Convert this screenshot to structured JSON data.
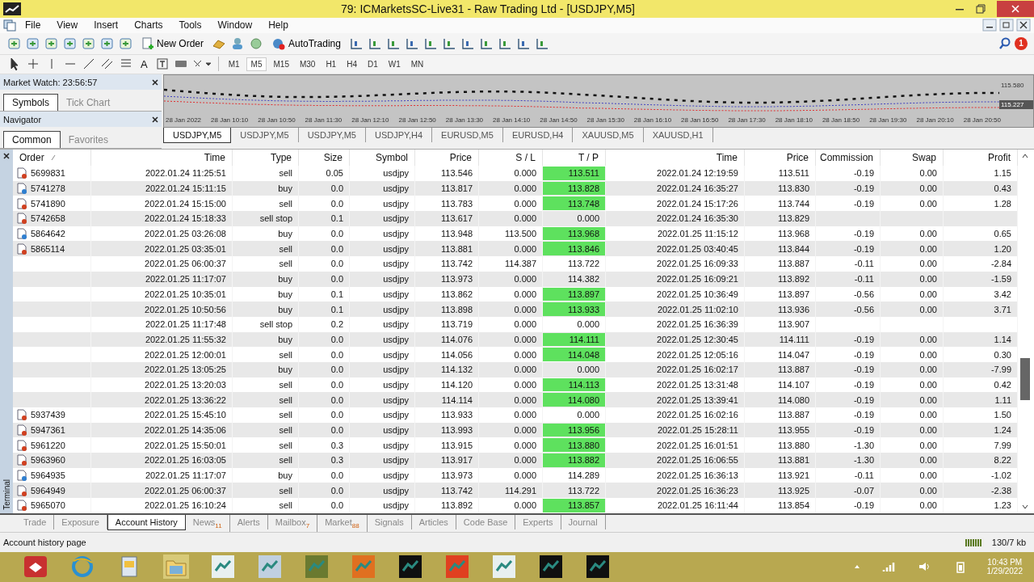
{
  "window": {
    "title": "79: ICMarketsSC-Live31 - Raw Trading Ltd - [USDJPY,M5]"
  },
  "menu": [
    "File",
    "View",
    "Insert",
    "Charts",
    "Tools",
    "Window",
    "Help"
  ],
  "toolbar": {
    "new_order": "New Order",
    "auto_trading": "AutoTrading",
    "text_tool": "A",
    "notifications": "1"
  },
  "timeframes": [
    {
      "label": "M1",
      "selected": false
    },
    {
      "label": "M5",
      "selected": true
    },
    {
      "label": "M15",
      "selected": false
    },
    {
      "label": "M30",
      "selected": false
    },
    {
      "label": "H1",
      "selected": false
    },
    {
      "label": "H4",
      "selected": false
    },
    {
      "label": "D1",
      "selected": false
    },
    {
      "label": "W1",
      "selected": false
    },
    {
      "label": "MN",
      "selected": false
    }
  ],
  "market_watch": {
    "title": "Market Watch: 23:56:57",
    "tabs": [
      {
        "label": "Symbols",
        "selected": true
      },
      {
        "label": "Tick Chart",
        "selected": false
      }
    ]
  },
  "navigator": {
    "title": "Navigator",
    "tabs": [
      {
        "label": "Common",
        "selected": true
      },
      {
        "label": "Favorites",
        "selected": false
      }
    ]
  },
  "chart": {
    "price_labels": [
      {
        "label": "115.580",
        "current": false
      },
      {
        "label": "115.227",
        "current": true
      }
    ],
    "time_labels": [
      "28 Jan 2022",
      "28 Jan 10:10",
      "28 Jan 10:50",
      "28 Jan 11:30",
      "28 Jan 12:10",
      "28 Jan 12:50",
      "28 Jan 13:30",
      "28 Jan 14:10",
      "28 Jan 14:50",
      "28 Jan 15:30",
      "28 Jan 16:10",
      "28 Jan 16:50",
      "28 Jan 17:30",
      "28 Jan 18:10",
      "28 Jan 18:50",
      "28 Jan 19:30",
      "28 Jan 20:10",
      "28 Jan 20:50"
    ]
  },
  "chart_tabs": [
    {
      "label": "USDJPY,M5",
      "selected": true
    },
    {
      "label": "USDJPY,M5",
      "selected": false
    },
    {
      "label": "USDJPY,M5",
      "selected": false
    },
    {
      "label": "USDJPY,H4",
      "selected": false
    },
    {
      "label": "EURUSD,M5",
      "selected": false
    },
    {
      "label": "EURUSD,H4",
      "selected": false
    },
    {
      "label": "XAUUSD,M5",
      "selected": false
    },
    {
      "label": "XAUUSD,H1",
      "selected": false
    }
  ],
  "table": {
    "columns": [
      "Order",
      "Time",
      "Type",
      "Size",
      "Symbol",
      "Price",
      "S / L",
      "T / P",
      "Time",
      "Price",
      "Commission",
      "Swap",
      "Profit"
    ],
    "rows": [
      {
        "kind": "sell",
        "order": "5699831",
        "time": "2022.01.24 11:25:51",
        "type": "sell",
        "size": "0.05",
        "symbol": "usdjpy",
        "price": "113.546",
        "sl": "0.000",
        "tp": "113.511",
        "tp_hit": true,
        "close_time": "2022.01.24 12:19:59",
        "close_price": "113.511",
        "commission": "-0.19",
        "swap": "0.00",
        "profit": "1.15"
      },
      {
        "kind": "buy",
        "order": "5741278",
        "time": "2022.01.24 15:11:15",
        "type": "buy",
        "size": "0.0",
        "symbol": "usdjpy",
        "price": "113.817",
        "sl": "0.000",
        "tp": "113.828",
        "tp_hit": true,
        "close_time": "2022.01.24 16:35:27",
        "close_price": "113.830",
        "commission": "-0.19",
        "swap": "0.00",
        "profit": "0.43"
      },
      {
        "kind": "sell",
        "order": "5741890",
        "time": "2022.01.24 15:15:00",
        "type": "sell",
        "size": "0.0",
        "symbol": "usdjpy",
        "price": "113.783",
        "sl": "0.000",
        "tp": "113.748",
        "tp_hit": true,
        "close_time": "2022.01.24 15:17:26",
        "close_price": "113.744",
        "commission": "-0.19",
        "swap": "0.00",
        "profit": "1.28"
      },
      {
        "kind": "sell",
        "order": "5742658",
        "time": "2022.01.24 15:18:33",
        "type": "sell stop",
        "size": "0.1",
        "symbol": "usdjpy",
        "price": "113.617",
        "sl": "0.000",
        "tp": "0.000",
        "tp_hit": false,
        "close_time": "2022.01.24 16:35:30",
        "close_price": "113.829"
      },
      {
        "kind": "buy",
        "order": "5864642",
        "time": "2022.01.25 03:26:08",
        "type": "buy",
        "size": "0.0",
        "symbol": "usdjpy",
        "price": "113.948",
        "sl": "113.500",
        "tp": "113.968",
        "tp_hit": true,
        "close_time": "2022.01.25 11:15:12",
        "close_price": "113.968",
        "commission": "-0.19",
        "swap": "0.00",
        "profit": "0.65"
      },
      {
        "kind": "sell",
        "order": "5865114",
        "time": "2022.01.25 03:35:01",
        "type": "sell",
        "size": "0.0",
        "symbol": "usdjpy",
        "price": "113.881",
        "sl": "0.000",
        "tp": "113.846",
        "tp_hit": true,
        "close_time": "2022.01.25 03:40:45",
        "close_price": "113.844",
        "commission": "-0.19",
        "swap": "0.00",
        "profit": "1.20"
      },
      {
        "time": "2022.01.25 06:00:37",
        "type": "sell",
        "size": "0.0",
        "symbol": "usdjpy",
        "price": "113.742",
        "sl": "114.387",
        "tp": "113.722",
        "tp_hit": false,
        "close_time": "2022.01.25 16:09:33",
        "close_price": "113.887",
        "commission": "-0.11",
        "swap": "0.00",
        "profit": "-2.84"
      },
      {
        "time": "2022.01.25 11:17:07",
        "type": "buy",
        "size": "0.0",
        "symbol": "usdjpy",
        "price": "113.973",
        "sl": "0.000",
        "tp": "114.382",
        "tp_hit": false,
        "close_time": "2022.01.25 16:09:21",
        "close_price": "113.892",
        "commission": "-0.11",
        "swap": "0.00",
        "profit": "-1.59"
      },
      {
        "time": "2022.01.25 10:35:01",
        "type": "buy",
        "size": "0.1",
        "symbol": "usdjpy",
        "price": "113.862",
        "sl": "0.000",
        "tp": "113.897",
        "tp_hit": true,
        "close_time": "2022.01.25 10:36:49",
        "close_price": "113.897",
        "commission": "-0.56",
        "swap": "0.00",
        "profit": "3.42"
      },
      {
        "time": "2022.01.25 10:50:56",
        "type": "buy",
        "size": "0.1",
        "symbol": "usdjpy",
        "price": "113.898",
        "sl": "0.000",
        "tp": "113.933",
        "tp_hit": true,
        "close_time": "2022.01.25 11:02:10",
        "close_price": "113.936",
        "commission": "-0.56",
        "swap": "0.00",
        "profit": "3.71"
      },
      {
        "time": "2022.01.25 11:17:48",
        "type": "sell stop",
        "size": "0.2",
        "symbol": "usdjpy",
        "price": "113.719",
        "sl": "0.000",
        "tp": "0.000",
        "tp_hit": false,
        "close_time": "2022.01.25 16:36:39",
        "close_price": "113.907"
      },
      {
        "time": "2022.01.25 11:55:32",
        "type": "buy",
        "size": "0.0",
        "symbol": "usdjpy",
        "price": "114.076",
        "sl": "0.000",
        "tp": "114.111",
        "tp_hit": true,
        "close_time": "2022.01.25 12:30:45",
        "close_price": "114.111",
        "commission": "-0.19",
        "swap": "0.00",
        "profit": "1.14"
      },
      {
        "time": "2022.01.25 12:00:01",
        "type": "sell",
        "size": "0.0",
        "symbol": "usdjpy",
        "price": "114.056",
        "sl": "0.000",
        "tp": "114.048",
        "tp_hit": true,
        "close_time": "2022.01.25 12:05:16",
        "close_price": "114.047",
        "commission": "-0.19",
        "swap": "0.00",
        "profit": "0.30"
      },
      {
        "time": "2022.01.25 13:05:25",
        "type": "buy",
        "size": "0.0",
        "symbol": "usdjpy",
        "price": "114.132",
        "sl": "0.000",
        "tp": "0.000",
        "tp_hit": false,
        "close_time": "2022.01.25 16:02:17",
        "close_price": "113.887",
        "commission": "-0.19",
        "swap": "0.00",
        "profit": "-7.99"
      },
      {
        "time": "2022.01.25 13:20:03",
        "type": "sell",
        "size": "0.0",
        "symbol": "usdjpy",
        "price": "114.120",
        "sl": "0.000",
        "tp": "114.113",
        "tp_hit": true,
        "close_time": "2022.01.25 13:31:48",
        "close_price": "114.107",
        "commission": "-0.19",
        "swap": "0.00",
        "profit": "0.42"
      },
      {
        "time": "2022.01.25 13:36:22",
        "type": "sell",
        "size": "0.0",
        "symbol": "usdjpy",
        "price": "114.114",
        "sl": "0.000",
        "tp": "114.080",
        "tp_hit": true,
        "close_time": "2022.01.25 13:39:41",
        "close_price": "114.080",
        "commission": "-0.19",
        "swap": "0.00",
        "profit": "1.11"
      },
      {
        "kind": "sell",
        "order": "5937439",
        "time": "2022.01.25 15:45:10",
        "type": "sell",
        "size": "0.0",
        "symbol": "usdjpy",
        "price": "113.933",
        "sl": "0.000",
        "tp": "0.000",
        "tp_hit": false,
        "close_time": "2022.01.25 16:02:16",
        "close_price": "113.887",
        "commission": "-0.19",
        "swap": "0.00",
        "profit": "1.50"
      },
      {
        "kind": "sell",
        "order": "5947361",
        "time": "2022.01.25 14:35:06",
        "type": "sell",
        "size": "0.0",
        "symbol": "usdjpy",
        "price": "113.993",
        "sl": "0.000",
        "tp": "113.956",
        "tp_hit": true,
        "close_time": "2022.01.25 15:28:11",
        "close_price": "113.955",
        "commission": "-0.19",
        "swap": "0.00",
        "profit": "1.24"
      },
      {
        "kind": "sell",
        "order": "5961220",
        "time": "2022.01.25 15:50:01",
        "type": "sell",
        "size": "0.3",
        "symbol": "usdjpy",
        "price": "113.915",
        "sl": "0.000",
        "tp": "113.880",
        "tp_hit": true,
        "close_time": "2022.01.25 16:01:51",
        "close_price": "113.880",
        "commission": "-1.30",
        "swap": "0.00",
        "profit": "7.99"
      },
      {
        "kind": "sell",
        "order": "5963960",
        "time": "2022.01.25 16:03:05",
        "type": "sell",
        "size": "0.3",
        "symbol": "usdjpy",
        "price": "113.917",
        "sl": "0.000",
        "tp": "113.882",
        "tp_hit": true,
        "close_time": "2022.01.25 16:06:55",
        "close_price": "113.881",
        "commission": "-1.30",
        "swap": "0.00",
        "profit": "8.22"
      },
      {
        "kind": "buy",
        "order": "5964935",
        "time": "2022.01.25 11:17:07",
        "type": "buy",
        "size": "0.0",
        "symbol": "usdjpy",
        "price": "113.973",
        "sl": "0.000",
        "tp": "114.289",
        "tp_hit": false,
        "close_time": "2022.01.25 16:36:13",
        "close_price": "113.921",
        "commission": "-0.11",
        "swap": "0.00",
        "profit": "-1.02"
      },
      {
        "kind": "sell",
        "order": "5964949",
        "time": "2022.01.25 06:00:37",
        "type": "sell",
        "size": "0.0",
        "symbol": "usdjpy",
        "price": "113.742",
        "sl": "114.291",
        "tp": "113.722",
        "tp_hit": false,
        "close_time": "2022.01.25 16:36:23",
        "close_price": "113.925",
        "commission": "-0.07",
        "swap": "0.00",
        "profit": "-2.38"
      },
      {
        "kind": "sell",
        "order": "5965070",
        "time": "2022.01.25 16:10:24",
        "type": "sell",
        "size": "0.0",
        "symbol": "usdjpy",
        "price": "113.892",
        "sl": "0.000",
        "tp": "113.857",
        "tp_hit": true,
        "close_time": "2022.01.25 16:11:44",
        "close_price": "113.854",
        "commission": "-0.19",
        "swap": "0.00",
        "profit": "1.23"
      }
    ]
  },
  "terminal_label": "Terminal",
  "terminal_tabs": [
    {
      "label": "Trade",
      "selected": false
    },
    {
      "label": "Exposure",
      "selected": false
    },
    {
      "label": "Account History",
      "selected": true
    },
    {
      "label": "News",
      "badge": "11",
      "selected": false
    },
    {
      "label": "Alerts",
      "selected": false
    },
    {
      "label": "Mailbox",
      "badge": "7",
      "selected": false
    },
    {
      "label": "Market",
      "badge": "88",
      "selected": false
    },
    {
      "label": "Signals",
      "selected": false
    },
    {
      "label": "Articles",
      "selected": false
    },
    {
      "label": "Code Base",
      "selected": false
    },
    {
      "label": "Experts",
      "selected": false
    },
    {
      "label": "Journal",
      "selected": false
    }
  ],
  "status_bar": {
    "message": "Account history page",
    "traffic": "130/7 kb"
  },
  "taskbar": {
    "time": "10:43 PM",
    "date": "1/29/2022"
  }
}
